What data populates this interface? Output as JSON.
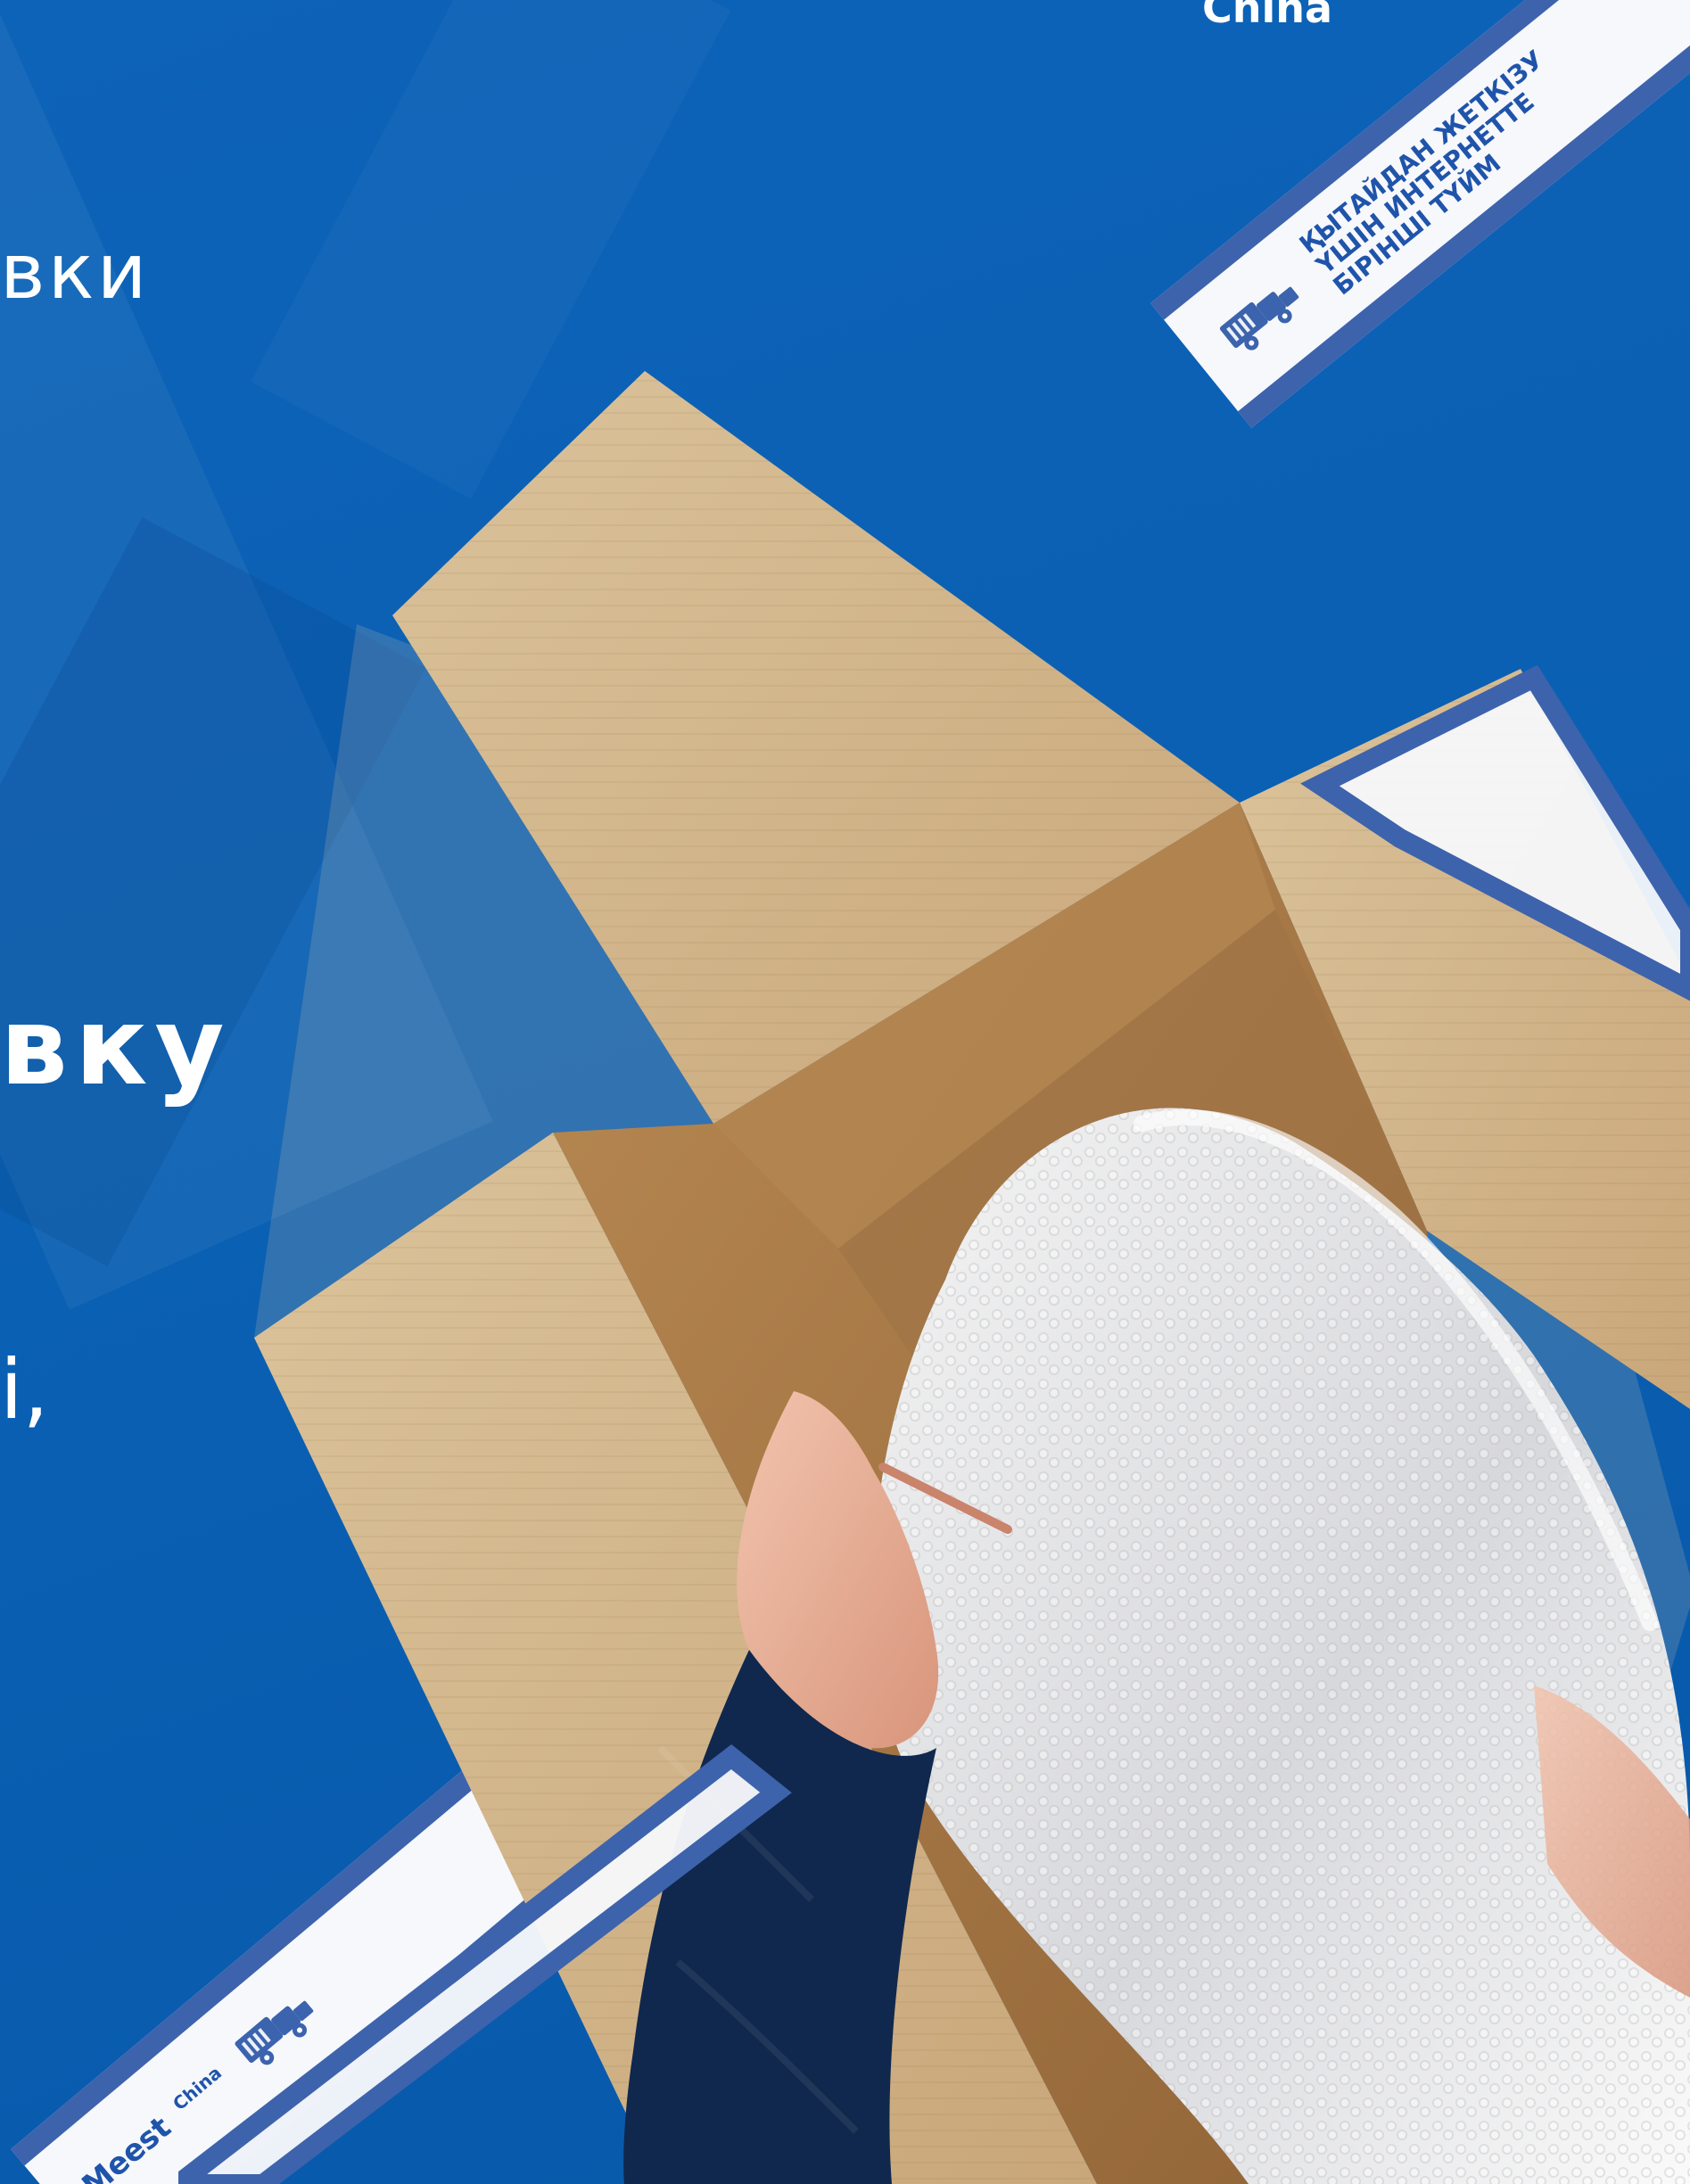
{
  "top_text": "China",
  "line_1": "вки",
  "line_2": "вку",
  "line_3": "і,",
  "top_tape": {
    "lines": [
      "ҚЫТАЙДАН ЖЕТКІЗУ",
      "ҮШІН ИНТЕРНЕТТЕ",
      "БІРІНШІ ТҮЙМ"
    ]
  },
  "bottom_tape": {
    "brand": "Meest",
    "sub": "China"
  },
  "icons": {
    "truck_top": "truck-icon",
    "truck_bottom": "truck-icon"
  },
  "colors": {
    "background": "#0a5fb4",
    "tape_blue": "#3d63ad",
    "tape_white": "#f7f8fb",
    "box": "#c8a779",
    "sleeve": "#10284d"
  }
}
